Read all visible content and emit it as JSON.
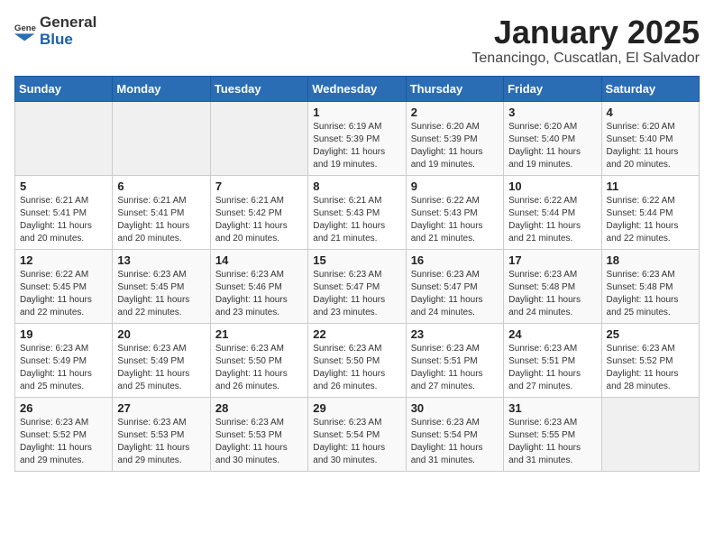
{
  "header": {
    "logo_general": "General",
    "logo_blue": "Blue",
    "month_title": "January 2025",
    "location": "Tenancingo, Cuscatlan, El Salvador"
  },
  "weekdays": [
    "Sunday",
    "Monday",
    "Tuesday",
    "Wednesday",
    "Thursday",
    "Friday",
    "Saturday"
  ],
  "weeks": [
    [
      {
        "day": "",
        "sunrise": "",
        "sunset": "",
        "daylight": ""
      },
      {
        "day": "",
        "sunrise": "",
        "sunset": "",
        "daylight": ""
      },
      {
        "day": "",
        "sunrise": "",
        "sunset": "",
        "daylight": ""
      },
      {
        "day": "1",
        "sunrise": "Sunrise: 6:19 AM",
        "sunset": "Sunset: 5:39 PM",
        "daylight": "Daylight: 11 hours and 19 minutes."
      },
      {
        "day": "2",
        "sunrise": "Sunrise: 6:20 AM",
        "sunset": "Sunset: 5:39 PM",
        "daylight": "Daylight: 11 hours and 19 minutes."
      },
      {
        "day": "3",
        "sunrise": "Sunrise: 6:20 AM",
        "sunset": "Sunset: 5:40 PM",
        "daylight": "Daylight: 11 hours and 19 minutes."
      },
      {
        "day": "4",
        "sunrise": "Sunrise: 6:20 AM",
        "sunset": "Sunset: 5:40 PM",
        "daylight": "Daylight: 11 hours and 20 minutes."
      }
    ],
    [
      {
        "day": "5",
        "sunrise": "Sunrise: 6:21 AM",
        "sunset": "Sunset: 5:41 PM",
        "daylight": "Daylight: 11 hours and 20 minutes."
      },
      {
        "day": "6",
        "sunrise": "Sunrise: 6:21 AM",
        "sunset": "Sunset: 5:41 PM",
        "daylight": "Daylight: 11 hours and 20 minutes."
      },
      {
        "day": "7",
        "sunrise": "Sunrise: 6:21 AM",
        "sunset": "Sunset: 5:42 PM",
        "daylight": "Daylight: 11 hours and 20 minutes."
      },
      {
        "day": "8",
        "sunrise": "Sunrise: 6:21 AM",
        "sunset": "Sunset: 5:43 PM",
        "daylight": "Daylight: 11 hours and 21 minutes."
      },
      {
        "day": "9",
        "sunrise": "Sunrise: 6:22 AM",
        "sunset": "Sunset: 5:43 PM",
        "daylight": "Daylight: 11 hours and 21 minutes."
      },
      {
        "day": "10",
        "sunrise": "Sunrise: 6:22 AM",
        "sunset": "Sunset: 5:44 PM",
        "daylight": "Daylight: 11 hours and 21 minutes."
      },
      {
        "day": "11",
        "sunrise": "Sunrise: 6:22 AM",
        "sunset": "Sunset: 5:44 PM",
        "daylight": "Daylight: 11 hours and 22 minutes."
      }
    ],
    [
      {
        "day": "12",
        "sunrise": "Sunrise: 6:22 AM",
        "sunset": "Sunset: 5:45 PM",
        "daylight": "Daylight: 11 hours and 22 minutes."
      },
      {
        "day": "13",
        "sunrise": "Sunrise: 6:23 AM",
        "sunset": "Sunset: 5:45 PM",
        "daylight": "Daylight: 11 hours and 22 minutes."
      },
      {
        "day": "14",
        "sunrise": "Sunrise: 6:23 AM",
        "sunset": "Sunset: 5:46 PM",
        "daylight": "Daylight: 11 hours and 23 minutes."
      },
      {
        "day": "15",
        "sunrise": "Sunrise: 6:23 AM",
        "sunset": "Sunset: 5:47 PM",
        "daylight": "Daylight: 11 hours and 23 minutes."
      },
      {
        "day": "16",
        "sunrise": "Sunrise: 6:23 AM",
        "sunset": "Sunset: 5:47 PM",
        "daylight": "Daylight: 11 hours and 24 minutes."
      },
      {
        "day": "17",
        "sunrise": "Sunrise: 6:23 AM",
        "sunset": "Sunset: 5:48 PM",
        "daylight": "Daylight: 11 hours and 24 minutes."
      },
      {
        "day": "18",
        "sunrise": "Sunrise: 6:23 AM",
        "sunset": "Sunset: 5:48 PM",
        "daylight": "Daylight: 11 hours and 25 minutes."
      }
    ],
    [
      {
        "day": "19",
        "sunrise": "Sunrise: 6:23 AM",
        "sunset": "Sunset: 5:49 PM",
        "daylight": "Daylight: 11 hours and 25 minutes."
      },
      {
        "day": "20",
        "sunrise": "Sunrise: 6:23 AM",
        "sunset": "Sunset: 5:49 PM",
        "daylight": "Daylight: 11 hours and 25 minutes."
      },
      {
        "day": "21",
        "sunrise": "Sunrise: 6:23 AM",
        "sunset": "Sunset: 5:50 PM",
        "daylight": "Daylight: 11 hours and 26 minutes."
      },
      {
        "day": "22",
        "sunrise": "Sunrise: 6:23 AM",
        "sunset": "Sunset: 5:50 PM",
        "daylight": "Daylight: 11 hours and 26 minutes."
      },
      {
        "day": "23",
        "sunrise": "Sunrise: 6:23 AM",
        "sunset": "Sunset: 5:51 PM",
        "daylight": "Daylight: 11 hours and 27 minutes."
      },
      {
        "day": "24",
        "sunrise": "Sunrise: 6:23 AM",
        "sunset": "Sunset: 5:51 PM",
        "daylight": "Daylight: 11 hours and 27 minutes."
      },
      {
        "day": "25",
        "sunrise": "Sunrise: 6:23 AM",
        "sunset": "Sunset: 5:52 PM",
        "daylight": "Daylight: 11 hours and 28 minutes."
      }
    ],
    [
      {
        "day": "26",
        "sunrise": "Sunrise: 6:23 AM",
        "sunset": "Sunset: 5:52 PM",
        "daylight": "Daylight: 11 hours and 29 minutes."
      },
      {
        "day": "27",
        "sunrise": "Sunrise: 6:23 AM",
        "sunset": "Sunset: 5:53 PM",
        "daylight": "Daylight: 11 hours and 29 minutes."
      },
      {
        "day": "28",
        "sunrise": "Sunrise: 6:23 AM",
        "sunset": "Sunset: 5:53 PM",
        "daylight": "Daylight: 11 hours and 30 minutes."
      },
      {
        "day": "29",
        "sunrise": "Sunrise: 6:23 AM",
        "sunset": "Sunset: 5:54 PM",
        "daylight": "Daylight: 11 hours and 30 minutes."
      },
      {
        "day": "30",
        "sunrise": "Sunrise: 6:23 AM",
        "sunset": "Sunset: 5:54 PM",
        "daylight": "Daylight: 11 hours and 31 minutes."
      },
      {
        "day": "31",
        "sunrise": "Sunrise: 6:23 AM",
        "sunset": "Sunset: 5:55 PM",
        "daylight": "Daylight: 11 hours and 31 minutes."
      },
      {
        "day": "",
        "sunrise": "",
        "sunset": "",
        "daylight": ""
      }
    ]
  ]
}
